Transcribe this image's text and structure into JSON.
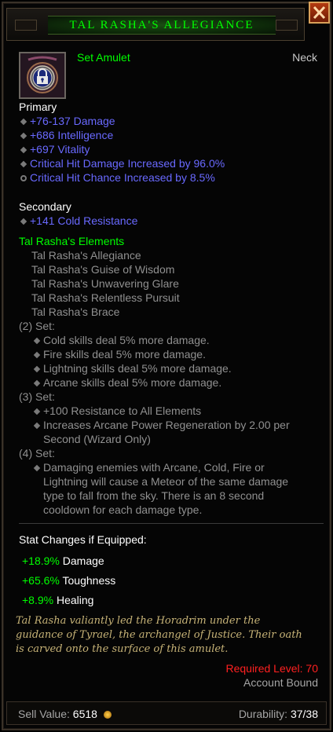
{
  "item": {
    "name": "TAL RASHA'S ALLEGIANCE",
    "type": "Set Amulet",
    "slot": "Neck",
    "icon": "amulet-lock-icon"
  },
  "primary": {
    "heading": "Primary",
    "stats": [
      "+76-137 Damage",
      "+686 Intelligence",
      "+697 Vitality",
      "Critical Hit Damage Increased by 96.0%",
      "Critical Hit Chance Increased by 8.5%"
    ]
  },
  "secondary": {
    "heading": "Secondary",
    "stats": [
      "+141 Cold Resistance"
    ]
  },
  "set": {
    "heading": "Tal Rasha's Elements",
    "items": [
      "Tal Rasha's Allegiance",
      "Tal Rasha's Guise of Wisdom",
      "Tal Rasha's Unwavering Glare",
      "Tal Rasha's Relentless Pursuit",
      "Tal Rasha's Brace"
    ],
    "bonus2_label": "(2) Set:",
    "bonus2": [
      "Cold skills deal 5% more damage.",
      "Fire skills deal 5% more damage.",
      "Lightning skills deal 5% more damage.",
      "Arcane skills deal 5% more damage."
    ],
    "bonus3_label": "(3) Set:",
    "bonus3": [
      "+100 Resistance to All Elements",
      "Increases Arcane Power Regeneration by 2.00 per",
      "Second (Wizard Only)"
    ],
    "bonus4_label": "(4) Set:",
    "bonus4": [
      "Damaging enemies with Arcane, Cold, Fire or",
      "Lightning will cause a Meteor of the same damage",
      "type to fall from the sky. There is an 8 second",
      "cooldown for each damage type."
    ]
  },
  "stat_changes": {
    "heading": "Stat Changes if Equipped:",
    "rows": [
      {
        "value": "+18.9%",
        "label": "Damage"
      },
      {
        "value": "+65.6%",
        "label": "Toughness"
      },
      {
        "value": "+8.9%",
        "label": "Healing"
      }
    ]
  },
  "flavor": [
    "Tal Rasha valiantly led the Horadrim under the",
    "guidance of Tyrael, the archangel of Justice. Their oath",
    "is carved onto the surface of this amulet."
  ],
  "requirements": {
    "level": "Required Level: 70",
    "binding": "Account Bound"
  },
  "footer": {
    "sell_label": "Sell Value:",
    "sell_value": "6518",
    "durability_label": "Durability:",
    "durability_value": "37/38"
  },
  "colors": {
    "set_green": "#00ff00",
    "magic_blue": "#6969ff",
    "legendary_red": "#ff2020",
    "flavor_gold": "#c7b377"
  }
}
